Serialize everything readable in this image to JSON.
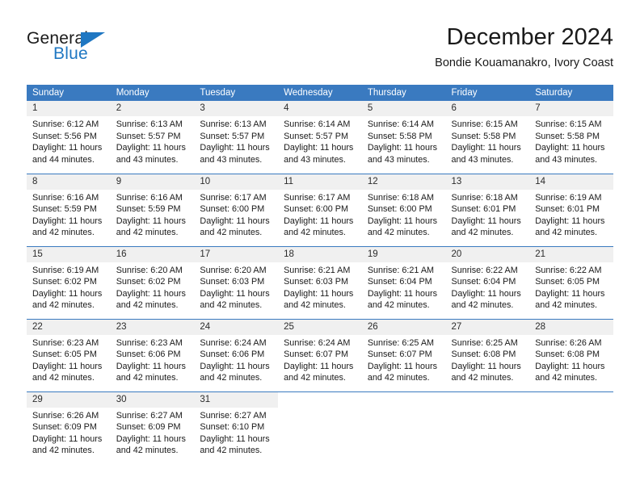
{
  "brand": {
    "name_part1": "General",
    "name_part2": "Blue",
    "triangle_icon": "brand-triangle-icon",
    "accent_color": "#1f77c2"
  },
  "header": {
    "title": "December 2024",
    "subtitle": "Bondie Kouamanakro, Ivory Coast"
  },
  "theme": {
    "header_blue": "#3a7ac0",
    "daynum_band": "#f0f0f0",
    "text": "#1a1a1a"
  },
  "weekdays": [
    "Sunday",
    "Monday",
    "Tuesday",
    "Wednesday",
    "Thursday",
    "Friday",
    "Saturday"
  ],
  "weeks": [
    [
      {
        "day": "1",
        "sunrise": "Sunrise: 6:12 AM",
        "sunset": "Sunset: 5:56 PM",
        "daylight": "Daylight: 11 hours and 44 minutes."
      },
      {
        "day": "2",
        "sunrise": "Sunrise: 6:13 AM",
        "sunset": "Sunset: 5:57 PM",
        "daylight": "Daylight: 11 hours and 43 minutes."
      },
      {
        "day": "3",
        "sunrise": "Sunrise: 6:13 AM",
        "sunset": "Sunset: 5:57 PM",
        "daylight": "Daylight: 11 hours and 43 minutes."
      },
      {
        "day": "4",
        "sunrise": "Sunrise: 6:14 AM",
        "sunset": "Sunset: 5:57 PM",
        "daylight": "Daylight: 11 hours and 43 minutes."
      },
      {
        "day": "5",
        "sunrise": "Sunrise: 6:14 AM",
        "sunset": "Sunset: 5:58 PM",
        "daylight": "Daylight: 11 hours and 43 minutes."
      },
      {
        "day": "6",
        "sunrise": "Sunrise: 6:15 AM",
        "sunset": "Sunset: 5:58 PM",
        "daylight": "Daylight: 11 hours and 43 minutes."
      },
      {
        "day": "7",
        "sunrise": "Sunrise: 6:15 AM",
        "sunset": "Sunset: 5:58 PM",
        "daylight": "Daylight: 11 hours and 43 minutes."
      }
    ],
    [
      {
        "day": "8",
        "sunrise": "Sunrise: 6:16 AM",
        "sunset": "Sunset: 5:59 PM",
        "daylight": "Daylight: 11 hours and 42 minutes."
      },
      {
        "day": "9",
        "sunrise": "Sunrise: 6:16 AM",
        "sunset": "Sunset: 5:59 PM",
        "daylight": "Daylight: 11 hours and 42 minutes."
      },
      {
        "day": "10",
        "sunrise": "Sunrise: 6:17 AM",
        "sunset": "Sunset: 6:00 PM",
        "daylight": "Daylight: 11 hours and 42 minutes."
      },
      {
        "day": "11",
        "sunrise": "Sunrise: 6:17 AM",
        "sunset": "Sunset: 6:00 PM",
        "daylight": "Daylight: 11 hours and 42 minutes."
      },
      {
        "day": "12",
        "sunrise": "Sunrise: 6:18 AM",
        "sunset": "Sunset: 6:00 PM",
        "daylight": "Daylight: 11 hours and 42 minutes."
      },
      {
        "day": "13",
        "sunrise": "Sunrise: 6:18 AM",
        "sunset": "Sunset: 6:01 PM",
        "daylight": "Daylight: 11 hours and 42 minutes."
      },
      {
        "day": "14",
        "sunrise": "Sunrise: 6:19 AM",
        "sunset": "Sunset: 6:01 PM",
        "daylight": "Daylight: 11 hours and 42 minutes."
      }
    ],
    [
      {
        "day": "15",
        "sunrise": "Sunrise: 6:19 AM",
        "sunset": "Sunset: 6:02 PM",
        "daylight": "Daylight: 11 hours and 42 minutes."
      },
      {
        "day": "16",
        "sunrise": "Sunrise: 6:20 AM",
        "sunset": "Sunset: 6:02 PM",
        "daylight": "Daylight: 11 hours and 42 minutes."
      },
      {
        "day": "17",
        "sunrise": "Sunrise: 6:20 AM",
        "sunset": "Sunset: 6:03 PM",
        "daylight": "Daylight: 11 hours and 42 minutes."
      },
      {
        "day": "18",
        "sunrise": "Sunrise: 6:21 AM",
        "sunset": "Sunset: 6:03 PM",
        "daylight": "Daylight: 11 hours and 42 minutes."
      },
      {
        "day": "19",
        "sunrise": "Sunrise: 6:21 AM",
        "sunset": "Sunset: 6:04 PM",
        "daylight": "Daylight: 11 hours and 42 minutes."
      },
      {
        "day": "20",
        "sunrise": "Sunrise: 6:22 AM",
        "sunset": "Sunset: 6:04 PM",
        "daylight": "Daylight: 11 hours and 42 minutes."
      },
      {
        "day": "21",
        "sunrise": "Sunrise: 6:22 AM",
        "sunset": "Sunset: 6:05 PM",
        "daylight": "Daylight: 11 hours and 42 minutes."
      }
    ],
    [
      {
        "day": "22",
        "sunrise": "Sunrise: 6:23 AM",
        "sunset": "Sunset: 6:05 PM",
        "daylight": "Daylight: 11 hours and 42 minutes."
      },
      {
        "day": "23",
        "sunrise": "Sunrise: 6:23 AM",
        "sunset": "Sunset: 6:06 PM",
        "daylight": "Daylight: 11 hours and 42 minutes."
      },
      {
        "day": "24",
        "sunrise": "Sunrise: 6:24 AM",
        "sunset": "Sunset: 6:06 PM",
        "daylight": "Daylight: 11 hours and 42 minutes."
      },
      {
        "day": "25",
        "sunrise": "Sunrise: 6:24 AM",
        "sunset": "Sunset: 6:07 PM",
        "daylight": "Daylight: 11 hours and 42 minutes."
      },
      {
        "day": "26",
        "sunrise": "Sunrise: 6:25 AM",
        "sunset": "Sunset: 6:07 PM",
        "daylight": "Daylight: 11 hours and 42 minutes."
      },
      {
        "day": "27",
        "sunrise": "Sunrise: 6:25 AM",
        "sunset": "Sunset: 6:08 PM",
        "daylight": "Daylight: 11 hours and 42 minutes."
      },
      {
        "day": "28",
        "sunrise": "Sunrise: 6:26 AM",
        "sunset": "Sunset: 6:08 PM",
        "daylight": "Daylight: 11 hours and 42 minutes."
      }
    ],
    [
      {
        "day": "29",
        "sunrise": "Sunrise: 6:26 AM",
        "sunset": "Sunset: 6:09 PM",
        "daylight": "Daylight: 11 hours and 42 minutes."
      },
      {
        "day": "30",
        "sunrise": "Sunrise: 6:27 AM",
        "sunset": "Sunset: 6:09 PM",
        "daylight": "Daylight: 11 hours and 42 minutes."
      },
      {
        "day": "31",
        "sunrise": "Sunrise: 6:27 AM",
        "sunset": "Sunset: 6:10 PM",
        "daylight": "Daylight: 11 hours and 42 minutes."
      },
      {
        "day": "",
        "sunrise": "",
        "sunset": "",
        "daylight": ""
      },
      {
        "day": "",
        "sunrise": "",
        "sunset": "",
        "daylight": ""
      },
      {
        "day": "",
        "sunrise": "",
        "sunset": "",
        "daylight": ""
      },
      {
        "day": "",
        "sunrise": "",
        "sunset": "",
        "daylight": ""
      }
    ]
  ]
}
